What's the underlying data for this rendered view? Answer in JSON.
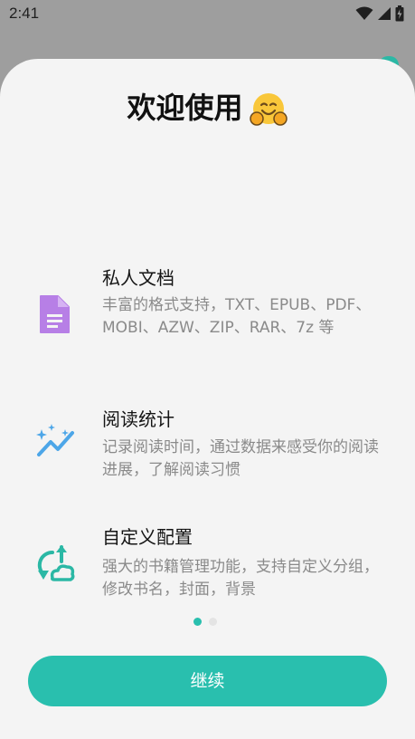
{
  "status_bar": {
    "time": "2:41",
    "icons": [
      "wifi-icon",
      "signal-icon",
      "battery-icon"
    ]
  },
  "welcome": {
    "title": "欢迎使用",
    "emoji": "hugging-face-emoji"
  },
  "features": [
    {
      "icon": "document-icon",
      "icon_color": "#b77fe6",
      "title": "私人文档",
      "description": "丰富的格式支持，TXT、EPUB、PDF、MOBI、AZW、ZIP、RAR、7z 等"
    },
    {
      "icon": "sparkle-chart-icon",
      "icon_color": "#4da6e8",
      "title": "阅读统计",
      "description": "记录阅读时间，通过数据来感受你的阅读进展，了解阅读习惯"
    },
    {
      "icon": "sync-cloud-icon",
      "icon_color": "#2bb8a5",
      "title": "自定义配置",
      "description": "强大的书籍管理功能，支持自定义分组，修改书名，封面，背景"
    }
  ],
  "pager": {
    "total_pages": 2,
    "current_page": 1
  },
  "continue_button": {
    "label": "继续"
  },
  "colors": {
    "accent": "#29bfae",
    "sheet_background": "#f4f4f4",
    "scrim": "#9e9e9e"
  }
}
